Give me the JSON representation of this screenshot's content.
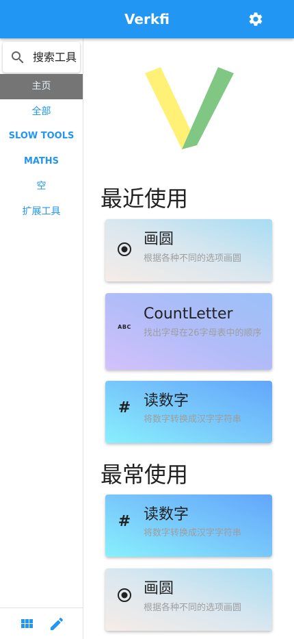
{
  "app": {
    "title": "Verkfi"
  },
  "icons": {
    "settings": "gear-icon",
    "search": "search-icon",
    "grid": "grid-icon",
    "edit": "pencil-icon"
  },
  "colors": {
    "primary": "#2196f3",
    "nav_active_bg": "#757575",
    "logo_yellow": "#fff176",
    "logo_green": "#81c784"
  },
  "sidebar": {
    "search": {
      "placeholder": "搜索工具"
    },
    "items": [
      {
        "label": "主页",
        "active": true
      },
      {
        "label": "全部",
        "active": false
      },
      {
        "label": "SLOW TOOLS",
        "active": false
      },
      {
        "label": "MATHS",
        "active": false
      },
      {
        "label": "空",
        "active": false
      },
      {
        "label": "扩展工具",
        "active": false
      }
    ]
  },
  "main": {
    "recent": {
      "title": "最近使用",
      "cards": [
        {
          "icon": "radio-button-icon",
          "title": "画圆",
          "desc": "根据各种不同的选项画圆"
        },
        {
          "icon": "abc-icon",
          "title": "CountLetter",
          "desc": "找出字母在26字母表中的顺序"
        },
        {
          "icon": "hash-icon",
          "title": "读数字",
          "desc": "将数字转换成汉字字符串"
        }
      ]
    },
    "frequent": {
      "title": "最常使用",
      "cards": [
        {
          "icon": "hash-icon",
          "title": "读数字",
          "desc": "将数字转换成汉字字符串"
        },
        {
          "icon": "radio-button-icon",
          "title": "画圆",
          "desc": "根据各种不同的选项画圆"
        }
      ]
    }
  }
}
